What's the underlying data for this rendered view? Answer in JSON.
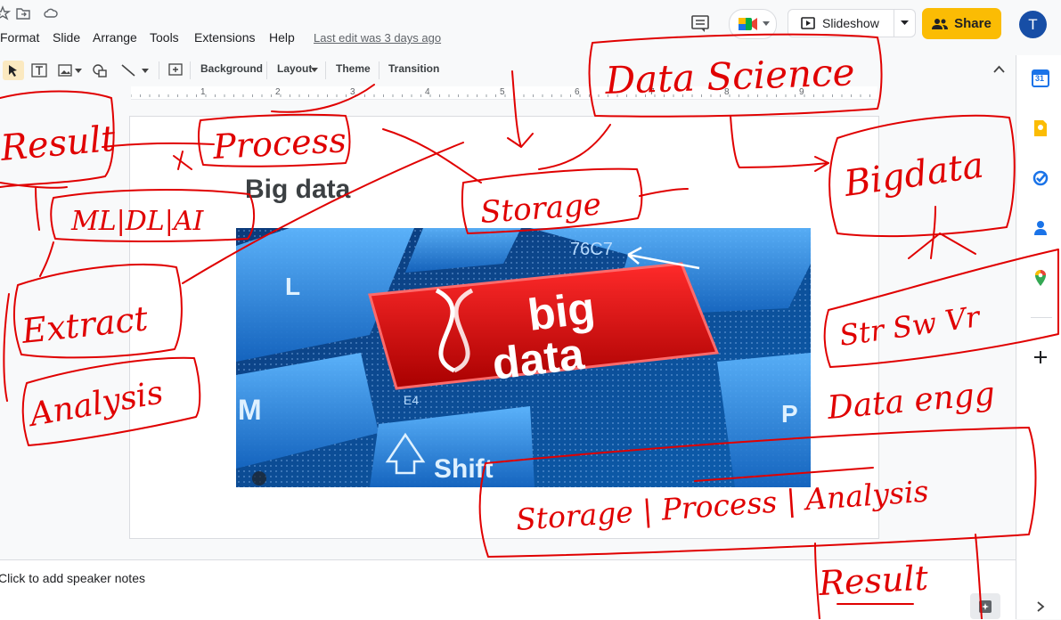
{
  "menu": {
    "items": [
      "Format",
      "Slide",
      "Arrange",
      "Tools",
      "Extensions",
      "Help"
    ],
    "last_edit": "Last edit was 3 days ago"
  },
  "header": {
    "slideshow_label": "Slideshow",
    "share_label": "Share",
    "avatar_initial": "T"
  },
  "toolbar": {
    "background_label": "Background",
    "layout_label": "Layout",
    "theme_label": "Theme",
    "transition_label": "Transition"
  },
  "ruler": {
    "marks": [
      "1",
      "2",
      "3",
      "4",
      "5",
      "6",
      "7",
      "8",
      "9"
    ]
  },
  "slide": {
    "title": "Big data",
    "image": {
      "key_text_1": "big",
      "key_text_2": "data",
      "shift_label": "Shift",
      "letters": [
        "L",
        "M",
        "E4",
        "76C7",
        "P"
      ]
    }
  },
  "notes": {
    "placeholder": "Click to add speaker notes"
  },
  "sidepanel": {
    "icons": [
      "calendar-icon",
      "keep-icon",
      "tasks-icon",
      "contacts-icon",
      "maps-icon",
      "add-icon"
    ],
    "calendar_day": "31"
  },
  "annotations": {
    "color": "#e00000",
    "texts": [
      "Result",
      "Process",
      "ML|DL|AI",
      "Extract",
      "Analysis",
      "Storage",
      "Data Science",
      "Bigdata",
      "Str Sw Vr",
      "Data engg",
      "Storage | Process | Analysis",
      "Result"
    ]
  },
  "colors": {
    "accent": "#fbbc04",
    "brand_blue": "#1a73e8",
    "ink": "#e00000"
  }
}
